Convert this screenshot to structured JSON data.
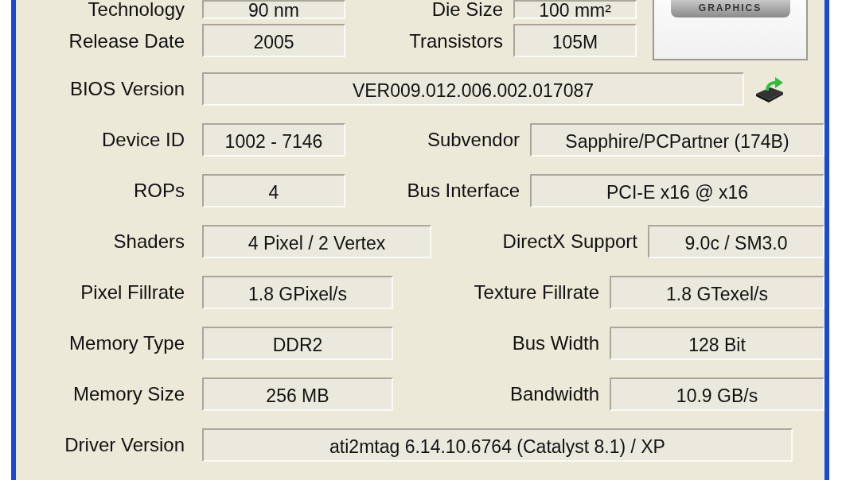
{
  "logo": {
    "text": "GRAPHICS"
  },
  "rows": [
    {
      "kind": "pair",
      "label": "Technology",
      "value": "90 nm",
      "label_2": "Die Size",
      "value_2": "100 mm²"
    },
    {
      "kind": "pair",
      "label": "Release Date",
      "value": "2005",
      "label_2": "Transistors",
      "value_2": "105M"
    },
    {
      "kind": "single_button",
      "label": "BIOS Version",
      "value": "VER009.012.006.002.017087"
    },
    {
      "kind": "pair",
      "label": "Device ID",
      "value": "1002 - 7146",
      "label_2": "Subvendor",
      "value_2": "Sapphire/PCPartner (174B)"
    },
    {
      "kind": "pair",
      "label": "ROPs",
      "value": "4",
      "label_2": "Bus Interface",
      "value_2": "PCI-E x16 @ x16"
    },
    {
      "kind": "pair",
      "label": "Shaders",
      "value": "4 Pixel / 2 Vertex",
      "label_2": "DirectX Support",
      "value_2": "9.0c / SM3.0"
    },
    {
      "kind": "pair",
      "label": "Pixel Fillrate",
      "value": "1.8 GPixel/s",
      "label_2": "Texture Fillrate",
      "value_2": "1.8 GTexel/s"
    },
    {
      "kind": "pair",
      "label": "Memory Type",
      "value": "DDR2",
      "label_2": "Bus Width",
      "value_2": "128 Bit"
    },
    {
      "kind": "pair",
      "label": "Memory Size",
      "value": "256 MB",
      "label_2": "Bandwidth",
      "value_2": "10.9 GB/s"
    },
    {
      "kind": "single",
      "label": "Driver Version",
      "value": "ati2mtag 6.14.10.6764 (Catalyst 8.1) / XP"
    }
  ]
}
